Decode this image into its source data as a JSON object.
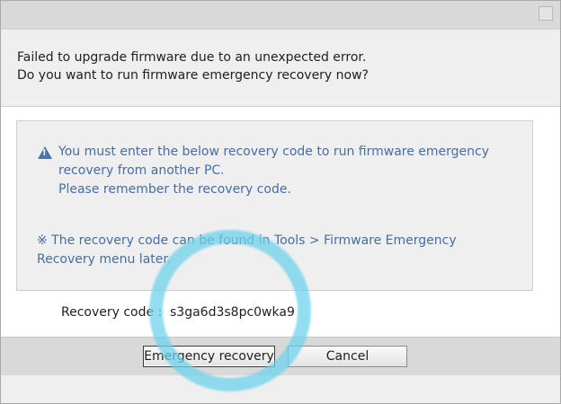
{
  "dialog": {
    "message_line1": "Failed to upgrade firmware due to an unexpected error.",
    "message_line2": "Do you want to run firmware emergency recovery now?"
  },
  "notice": {
    "warning_line1": "You must enter the below recovery code to run firmware emergency",
    "warning_line2": "recovery from another PC.",
    "warning_line3": "Please remember the recovery code.",
    "note_line1": "※ The recovery code can be found in Tools > Firmware Emergency",
    "note_line2": "Recovery menu later."
  },
  "recovery": {
    "label": "Recovery code :",
    "code": "s3ga6d3s8pc0wka9"
  },
  "buttons": {
    "emergency_label": "Emergency recovery",
    "cancel_label": "Cancel"
  },
  "icons": {
    "warning": "warning-triangle-icon",
    "close": "close-icon"
  },
  "colors": {
    "notice_text": "#456ea3",
    "highlight_ring": "#6ed2eb"
  }
}
